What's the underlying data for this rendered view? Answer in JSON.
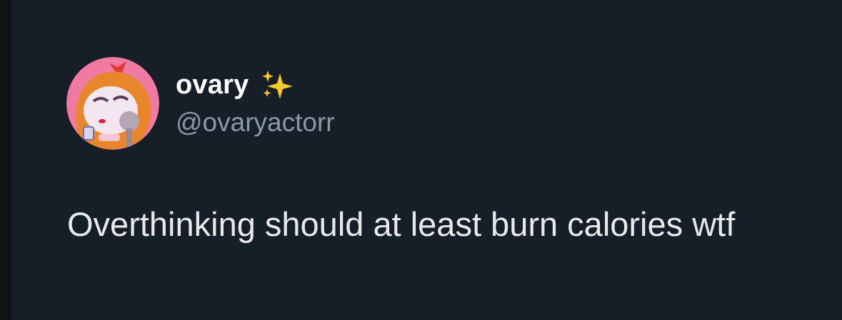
{
  "tweet": {
    "author": {
      "display_name": "ovary",
      "name_emoji": "sparkles-icon",
      "handle": "@ovaryactorr",
      "avatar": "cartoon-girl-avatar-icon"
    },
    "text": "Overthinking should at least burn calories wtf"
  },
  "colors": {
    "background": "#161e27",
    "outer_edge": "#111417",
    "name_text": "#ffffff",
    "handle_text": "#8b98a5",
    "body_text": "#e7e9ea",
    "sparkle": "#f9c929",
    "avatar_bg": "#f07aa1"
  }
}
